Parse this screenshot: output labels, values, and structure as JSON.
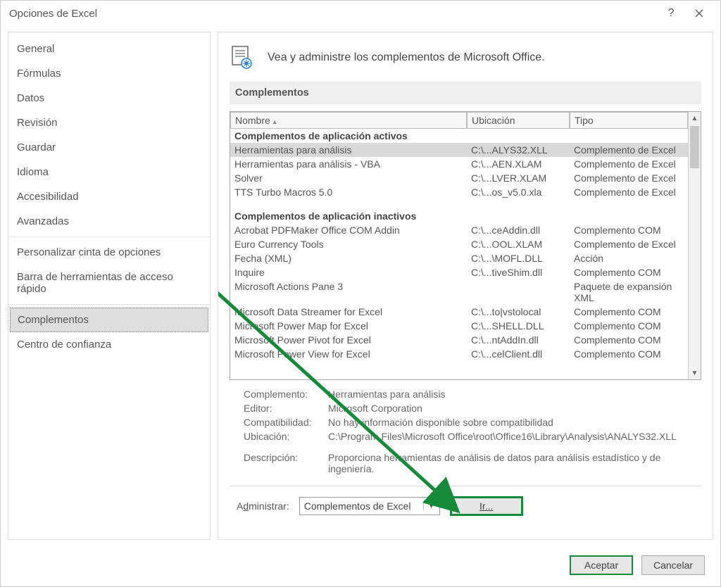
{
  "window": {
    "title": "Opciones de Excel"
  },
  "sidebar": {
    "group1": [
      "General",
      "Fórmulas",
      "Datos",
      "Revisión",
      "Guardar",
      "Idioma",
      "Accesibilidad",
      "Avanzadas"
    ],
    "group2": [
      "Personalizar cinta de opciones",
      "Barra de herramientas de acceso rápido"
    ],
    "group3": [
      "Complementos",
      "Centro de confianza"
    ],
    "selected": "Complementos"
  },
  "main": {
    "header": "Vea y administre los complementos de Microsoft Office.",
    "section": "Complementos",
    "columns": {
      "name": "Nombre",
      "loc": "Ubicación",
      "type": "Tipo"
    },
    "active_header": "Complementos de aplicación activos",
    "inactive_header": "Complementos de aplicación inactivos",
    "active": [
      {
        "n": "Herramientas para análisis",
        "u": "C:\\...ALYS32.XLL",
        "t": "Complemento de Excel",
        "sel": true
      },
      {
        "n": "Herramientas para análisis - VBA",
        "u": "C:\\...AEN.XLAM",
        "t": "Complemento de Excel"
      },
      {
        "n": "Solver",
        "u": "C:\\...LVER.XLAM",
        "t": "Complemento de Excel"
      },
      {
        "n": "TTS Turbo Macros 5.0",
        "u": "C:\\...os_v5.0.xla",
        "t": "Complemento de Excel"
      }
    ],
    "inactive": [
      {
        "n": "Acrobat PDFMaker Office COM Addin",
        "u": "C:\\...ceAddin.dll",
        "t": "Complemento COM"
      },
      {
        "n": "Euro Currency Tools",
        "u": "C:\\...OOL.XLAM",
        "t": "Complemento de Excel"
      },
      {
        "n": "Fecha (XML)",
        "u": "C:\\...\\MOFL.DLL",
        "t": "Acción"
      },
      {
        "n": "Inquire",
        "u": "C:\\...tiveShim.dll",
        "t": "Complemento COM"
      },
      {
        "n": "Microsoft Actions Pane 3",
        "u": "",
        "t": "Paquete de expansión XML"
      },
      {
        "n": "Microsoft Data Streamer for Excel",
        "u": "C:\\...to|vstolocal",
        "t": "Complemento COM"
      },
      {
        "n": "Microsoft Power Map for Excel",
        "u": "C:\\...SHELL.DLL",
        "t": "Complemento COM"
      },
      {
        "n": "Microsoft Power Pivot for Excel",
        "u": "C:\\...ntAddIn.dll",
        "t": "Complemento COM"
      },
      {
        "n": "Microsoft Power View for Excel",
        "u": "C:\\...celClient.dll",
        "t": "Complemento COM"
      }
    ],
    "details": {
      "addin_l": "Complemento:",
      "addin_v": "Herramientas para análisis",
      "editor_l": "Editor:",
      "editor_v": "Microsoft Corporation",
      "compat_l": "Compatibilidad:",
      "compat_v": "No hay información disponible sobre compatibilidad",
      "loc_l": "Ubicación:",
      "loc_v": "C:\\Program Files\\Microsoft Office\\root\\Office16\\Library\\Analysis\\ANALYS32.XLL",
      "desc_l": "Descripción:",
      "desc_v": "Proporciona herramientas de análisis de datos para análisis estadístico y de ingeniería."
    },
    "manage": {
      "label_pre": "A",
      "label_u": "d",
      "label_post": "ministrar:",
      "selected": "Complementos de Excel",
      "go_u": "I",
      "go_post": "r..."
    }
  },
  "footer": {
    "ok": "Aceptar",
    "cancel": "Cancelar"
  }
}
